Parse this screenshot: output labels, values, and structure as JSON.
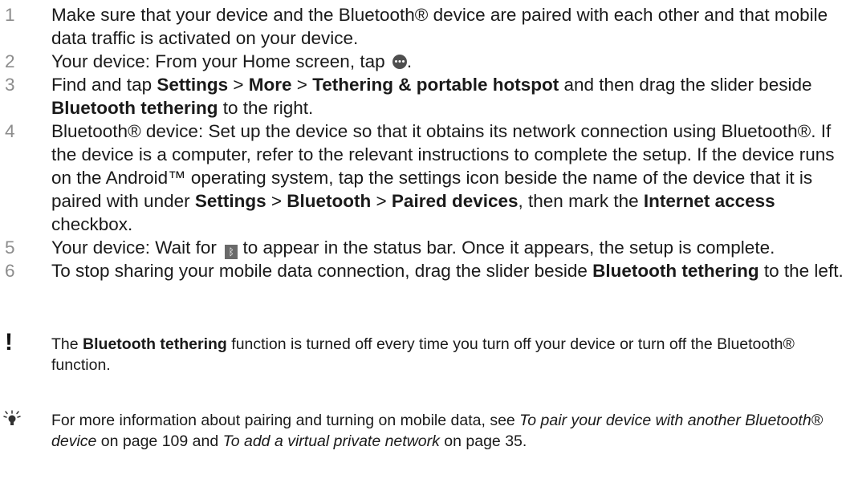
{
  "steps": [
    {
      "num": "1",
      "t1": "Make sure that your device and the Bluetooth® device are paired with each other and that mobile data traffic is activated on your device."
    },
    {
      "num": "2",
      "t1": "Your device: From your Home screen, tap ",
      "t2": ".",
      "icon": "apps-icon"
    },
    {
      "num": "3",
      "t1": "Find and tap ",
      "b1": "Settings",
      "t2": " > ",
      "b2": "More",
      "t3": " > ",
      "b3": "Tethering & portable hotspot",
      "t4": " and then drag the slider beside ",
      "b4": "Bluetooth tethering",
      "t5": " to the right."
    },
    {
      "num": "4",
      "t1": "Bluetooth® device: Set up the device so that it obtains its network connection using Bluetooth®. If the device is a computer, refer to the relevant instructions to complete the setup. If the device runs on the Android™ operating system, tap the settings icon beside the name of the device that it is paired with under ",
      "b1": "Settings",
      "t2": " > ",
      "b2": "Bluetooth",
      "t3": " > ",
      "b3": "Paired devices",
      "t4": ", then mark the ",
      "b4": "Internet access",
      "t5": " checkbox."
    },
    {
      "num": "5",
      "t1": "Your device: Wait for ",
      "t2": " to appear in the status bar. Once it appears, the setup is complete.",
      "icon": "bluetooth-status-icon"
    },
    {
      "num": "6",
      "t1": "To stop sharing your mobile data connection, drag the slider beside ",
      "b1": "Bluetooth tethering",
      "t2": " to the left."
    }
  ],
  "notes": [
    {
      "icon": "exclamation-icon",
      "t1": "The ",
      "b1": "Bluetooth tethering",
      "t2": " function is turned off every time you turn off your device or turn off the Bluetooth® function."
    },
    {
      "icon": "lightbulb-icon",
      "t1": "For more information about pairing and turning on mobile data, see ",
      "i1": "To pair your device with another Bluetooth® device",
      "t2": " on page 109 and ",
      "i2": "To add a virtual private network",
      "t3": " on page 35."
    }
  ]
}
